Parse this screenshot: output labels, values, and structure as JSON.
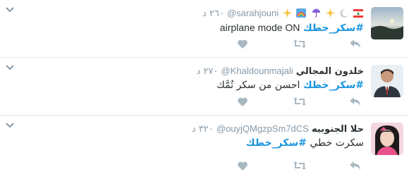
{
  "tweets": [
    {
      "name": "",
      "handle": "@sarahjouni",
      "time": "٢٦٠ د",
      "hashtag": "#سكر_خطك",
      "text": "airplane mode ON",
      "emojis": [
        "lebanon-flag",
        "moon",
        "sparkles",
        "umbrella",
        "rainbow",
        "sparkles"
      ]
    },
    {
      "name": "خلدون المجالي",
      "handle": "@Khaldounmajali",
      "time": "٢٧٠ د",
      "hashtag": "#سكر_خطك",
      "text": "احسن من سكر تُمَّك"
    },
    {
      "name": "حلا الجنوبيه",
      "handle": "@ouyjQMgzpSm7dCS",
      "time": "٣٢٠ د",
      "text": "سكرت خطي",
      "hashtag": "#سكر_خطك"
    }
  ],
  "colors": {
    "accent": "#1b95e0",
    "muted": "#8899a6",
    "divider": "#e1e8ed"
  },
  "icons": [
    "chevron-down-icon",
    "reply-icon",
    "retweet-icon",
    "like-icon"
  ]
}
